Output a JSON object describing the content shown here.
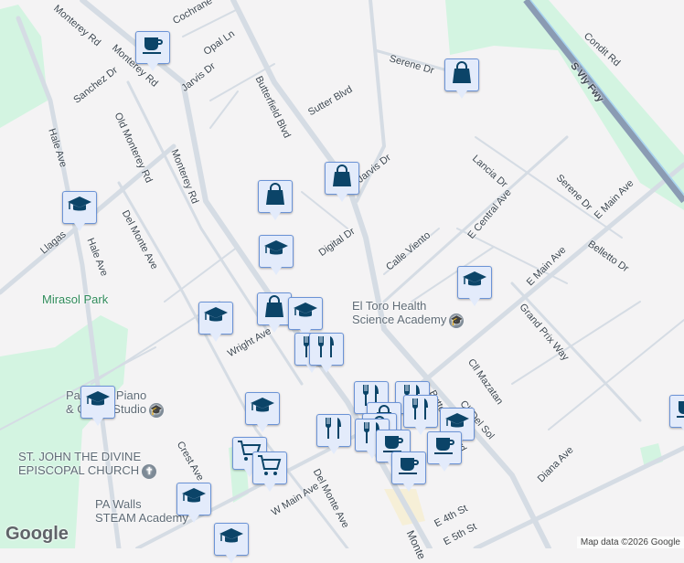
{
  "colors": {
    "background": "#f4f3f4",
    "park": "#d3f4e1",
    "road": "#d5dce4",
    "freeway": "#8a9bb3",
    "marker_bg": "#e3ebfb",
    "marker_icon": "#0b4468"
  },
  "streets": [
    {
      "id": "monterey-rd-top",
      "name": "Monterey Rd"
    },
    {
      "id": "monterey-rd-nw",
      "name": "Monterey Rd"
    },
    {
      "id": "monterey-rd",
      "name": "Monterey Rd"
    },
    {
      "id": "cochrane",
      "name": "Cochrane"
    },
    {
      "id": "opal-ln",
      "name": "Opal Ln"
    },
    {
      "id": "jarvis-dr-w",
      "name": "Jarvis Dr"
    },
    {
      "id": "sanchez-dr",
      "name": "Sanchez Dr"
    },
    {
      "id": "old-monterey-rd",
      "name": "Old Monterey Rd"
    },
    {
      "id": "hale-ave",
      "name": "Hale Ave"
    },
    {
      "id": "hale-ave-2",
      "name": "Hale Ave"
    },
    {
      "id": "llagas",
      "name": "Llagas"
    },
    {
      "id": "del-monte-ave",
      "name": "Del Monte Ave"
    },
    {
      "id": "butterfield-blvd",
      "name": "Butterfield Blvd"
    },
    {
      "id": "sutter-blvd",
      "name": "Sutter Blvd"
    },
    {
      "id": "serene-dr",
      "name": "Serene Dr"
    },
    {
      "id": "jarvis-dr",
      "name": "Jarvis Dr"
    },
    {
      "id": "digital-dr",
      "name": "Digital Dr"
    },
    {
      "id": "s-vly-fwy",
      "name": "S Vly Fwy"
    },
    {
      "id": "condit-rd",
      "name": "Condit Rd"
    },
    {
      "id": "lancia-dr",
      "name": "Lancia Dr"
    },
    {
      "id": "serene-dr-2",
      "name": "Serene Dr"
    },
    {
      "id": "e-central-ave",
      "name": "E Central Ave"
    },
    {
      "id": "calle-viento",
      "name": "Calle Viento"
    },
    {
      "id": "e-main-ave",
      "name": "E Main Ave"
    },
    {
      "id": "e-main-ave-2",
      "name": "E Main Ave"
    },
    {
      "id": "belletto-dr",
      "name": "Belletto Dr"
    },
    {
      "id": "grand-prix-way",
      "name": "Grand Prix Way"
    },
    {
      "id": "cll-mazatan",
      "name": "Cll Mazatan"
    },
    {
      "id": "cll-del-sol",
      "name": "Cll Del Sol"
    },
    {
      "id": "diana-ave",
      "name": "Diana Ave"
    },
    {
      "id": "wright-ave",
      "name": "Wright Ave"
    },
    {
      "id": "crest-ave",
      "name": "Crest Ave"
    },
    {
      "id": "w-main-ave",
      "name": "W Main Ave"
    },
    {
      "id": "del-monte-ave-2",
      "name": "Del Monte Ave"
    },
    {
      "id": "butterfield-blvd-2",
      "name": "Butterfield Blvd"
    },
    {
      "id": "e-4th-st",
      "name": "E 4th St"
    },
    {
      "id": "e-5th-st",
      "name": "E 5th St"
    },
    {
      "id": "monte",
      "name": "Monte"
    }
  ],
  "places": {
    "mirasol_park": "Mirasol Park",
    "el_toro": "El Toro Health\nScience Academy",
    "piano": "Paradise Piano\n& Guitar Studio",
    "church": "ST. JOHN THE DIVINE\nEPISCOPAL CHURCH",
    "steam": "PA Walls\nSTEAM Academy"
  },
  "markers": [
    {
      "type": "coffee"
    },
    {
      "type": "shopping"
    },
    {
      "type": "school"
    },
    {
      "type": "shopping"
    },
    {
      "type": "shopping"
    },
    {
      "type": "school"
    },
    {
      "type": "school"
    },
    {
      "type": "school"
    },
    {
      "type": "shopping"
    },
    {
      "type": "school"
    },
    {
      "type": "restaurant"
    },
    {
      "type": "restaurant"
    },
    {
      "type": "school"
    },
    {
      "type": "school"
    },
    {
      "type": "restaurant"
    },
    {
      "type": "cart"
    },
    {
      "type": "cart"
    },
    {
      "type": "school"
    },
    {
      "type": "school"
    },
    {
      "type": "restaurant"
    },
    {
      "type": "restaurant"
    },
    {
      "type": "shopping"
    },
    {
      "type": "restaurant"
    },
    {
      "type": "shopping"
    },
    {
      "type": "restaurant"
    },
    {
      "type": "school"
    },
    {
      "type": "coffee"
    },
    {
      "type": "coffee"
    },
    {
      "type": "coffee"
    },
    {
      "type": "coffee"
    }
  ],
  "footer": {
    "logo": "Google",
    "attribution": "Map data ©2026 Google"
  }
}
